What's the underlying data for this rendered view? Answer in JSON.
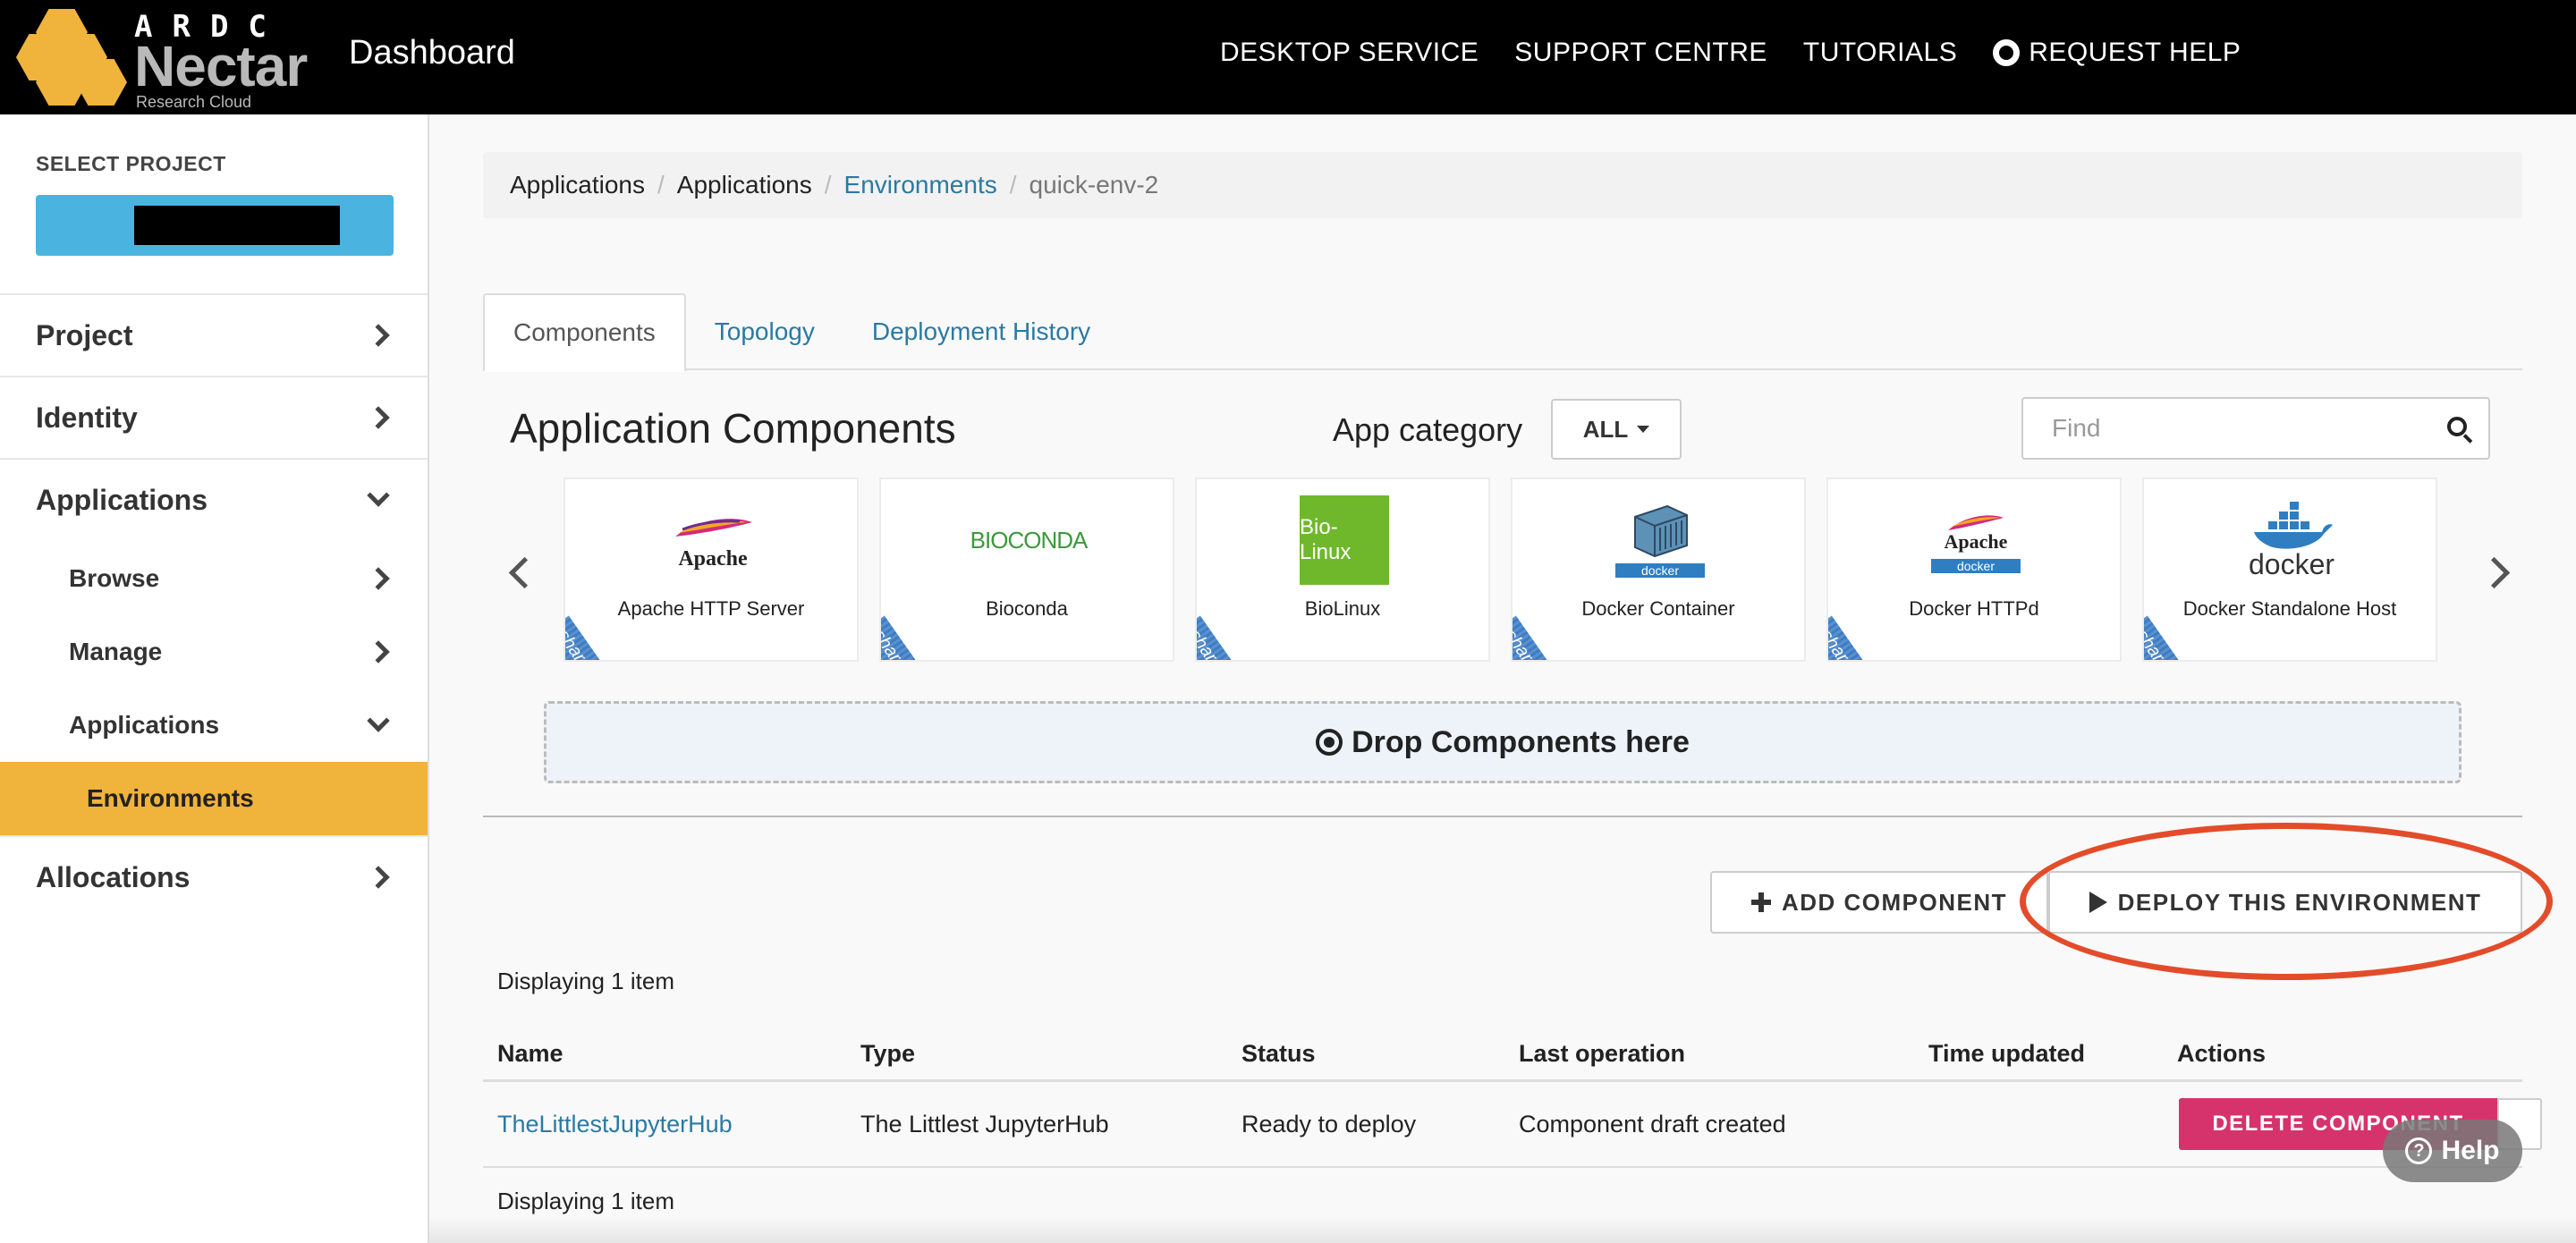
{
  "header": {
    "logo_top": "ARDC",
    "logo_main": "Nectar",
    "logo_sub": "Research Cloud",
    "title": "Dashboard",
    "nav": [
      "DESKTOP SERVICE",
      "SUPPORT CENTRE",
      "TUTORIALS",
      "REQUEST HELP"
    ]
  },
  "sidebar": {
    "select_project_label": "SELECT PROJECT",
    "items": [
      {
        "label": "Project",
        "icon": "chevron-right-icon"
      },
      {
        "label": "Identity",
        "icon": "chevron-right-icon"
      },
      {
        "label": "Applications",
        "icon": "chevron-down-icon"
      },
      {
        "label": "Browse",
        "icon": "chevron-right-icon"
      },
      {
        "label": "Manage",
        "icon": "chevron-right-icon"
      },
      {
        "label": "Applications",
        "icon": "chevron-down-icon"
      },
      {
        "label": "Environments"
      },
      {
        "label": "Allocations",
        "icon": "chevron-right-icon"
      }
    ]
  },
  "breadcrumb": [
    "Applications",
    "Applications",
    "Environments",
    "quick-env-2"
  ],
  "tabs": [
    "Components",
    "Topology",
    "Deployment History"
  ],
  "components": {
    "title": "Application Components",
    "category_label": "App category",
    "category_value": "ALL",
    "find_placeholder": "Find",
    "ribbon": "shared",
    "cards": [
      {
        "name": "Apache HTTP Server",
        "logo": "Apache"
      },
      {
        "name": "Bioconda",
        "logo": "BIOCONDA"
      },
      {
        "name": "BioLinux",
        "logo": "Bio-Linux"
      },
      {
        "name": "Docker Container",
        "logo": "docker"
      },
      {
        "name": "Docker HTTPd",
        "logo": "Apache",
        "logo_sub": "docker"
      },
      {
        "name": "Docker Standalone Host",
        "logo": "docker"
      }
    ],
    "drop_zone": "Drop Components here"
  },
  "actions": {
    "add": "ADD COMPONENT",
    "deploy": "DEPLOY THIS ENVIRONMENT"
  },
  "table": {
    "count_text": "Displaying 1 item",
    "headers": [
      "Name",
      "Type",
      "Status",
      "Last operation",
      "Time updated",
      "Actions"
    ],
    "rows": [
      {
        "name": "TheLittlestJupyterHub",
        "type": "The Littlest JupyterHub",
        "status": "Ready to deploy",
        "last_operation": "Component draft created",
        "time_updated": "",
        "action": "DELETE COMPONENT"
      }
    ]
  },
  "help": "Help",
  "colors": {
    "accent": "#f0b33c",
    "project_button": "#4ab3e0",
    "link": "#2a7aa3",
    "delete": "#d6336c",
    "highlight": "#e34c2a",
    "ribbon": "#3d7dc4"
  }
}
